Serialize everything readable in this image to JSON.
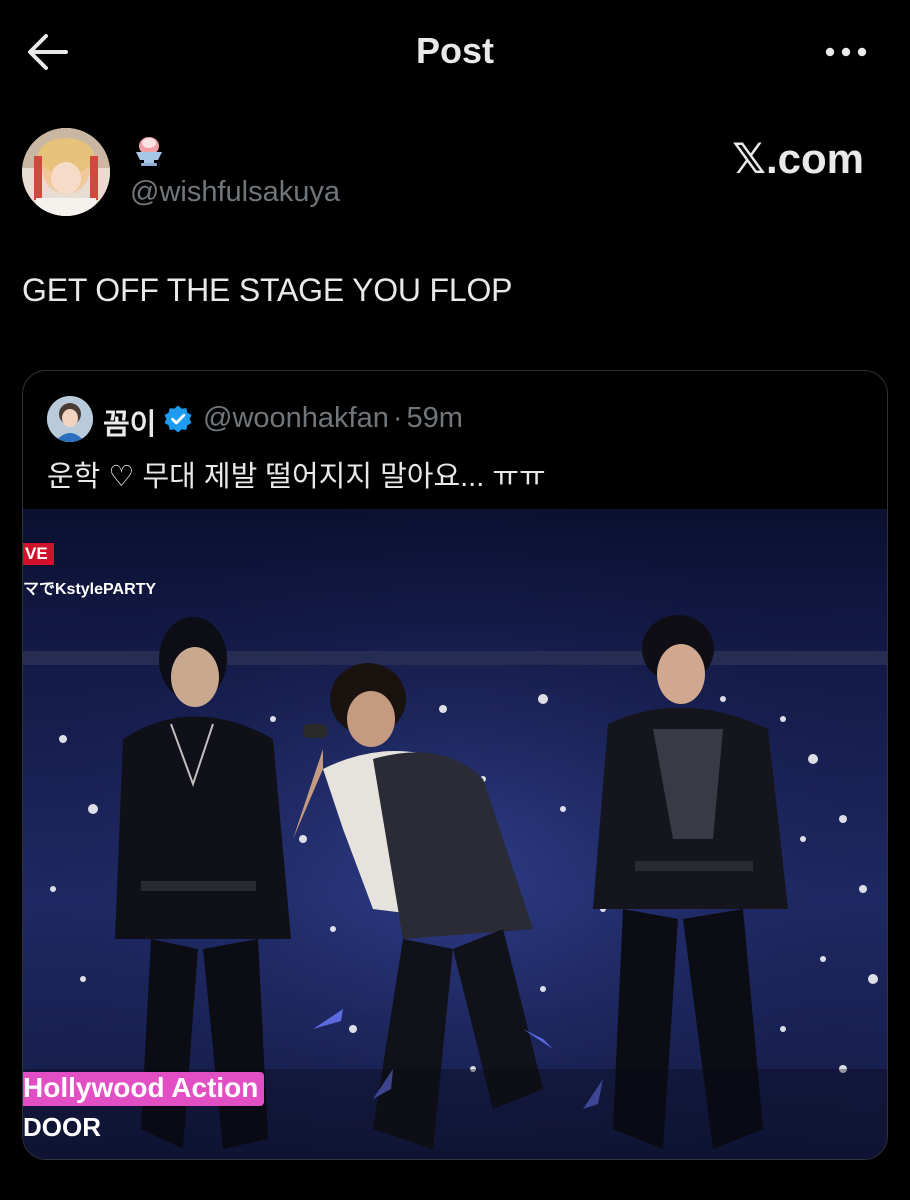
{
  "header": {
    "title": "Post"
  },
  "author": {
    "emoji": "🍧",
    "handle": "@wishfulsakuya",
    "source_brand": "𝕏.com"
  },
  "post": {
    "text": "GET OFF THE STAGE YOU FLOP"
  },
  "quoted_post": {
    "name": "꼼이",
    "handle": "@woonhakfan",
    "separator": "·",
    "time": "59m",
    "text": "운학 ♡ 무대 제발 떨어지지 말아요... ㅠㅠ",
    "media": {
      "live_badge": "VE",
      "channel_caption": "マでKstylePARTY",
      "song_caption": "Hollywood Action",
      "group_caption": "DOOR"
    }
  },
  "colors": {
    "background": "#000000",
    "text": "#e7e9ea",
    "muted": "#71767b",
    "border": "#2f3336",
    "verified": "#1d9bf0",
    "song_pink": "#e24fc4"
  }
}
